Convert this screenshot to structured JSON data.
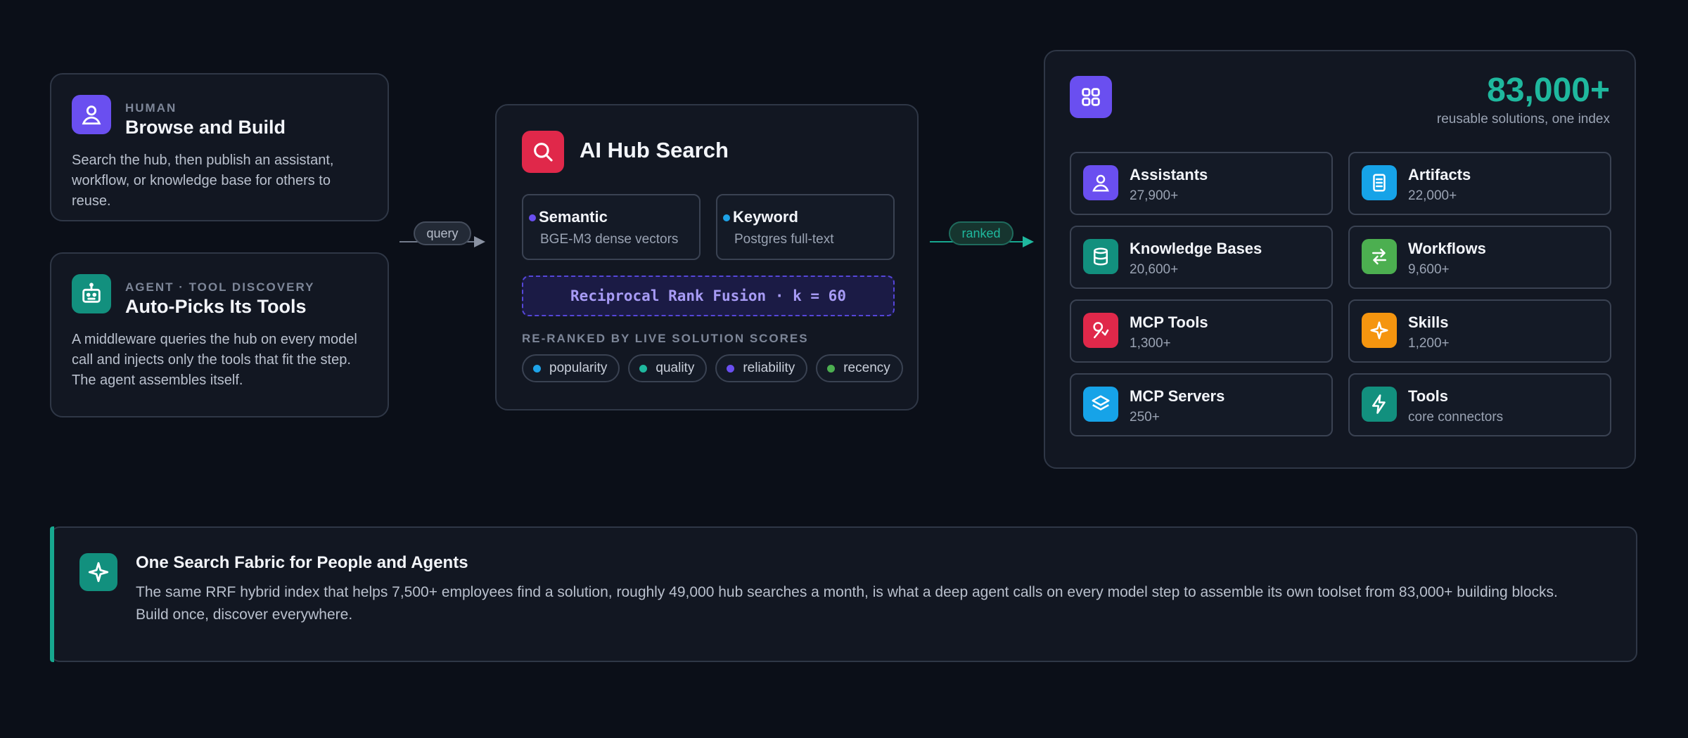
{
  "human": {
    "eyebrow": "HUMAN",
    "title": "Browse and Build",
    "body": "Search the hub, then publish an assistant, workflow, or knowledge base for others to reuse.",
    "icon": "person-icon"
  },
  "agent": {
    "eyebrow": "AGENT · TOOL DISCOVERY",
    "title": "Auto-Picks Its Tools",
    "body": "A middleware queries the hub on every model call and injects only the tools that fit the step. The agent assembles itself.",
    "icon": "robot-icon"
  },
  "query_label": "query",
  "ranked_label": "ranked",
  "search": {
    "title": "AI Hub Search",
    "icon": "search-icon",
    "semantic": {
      "title": "Semantic",
      "sub": "BGE-M3 dense vectors"
    },
    "keyword": {
      "title": "Keyword",
      "sub": "Postgres full-text"
    },
    "fusion": "Reciprocal Rank Fusion · k = 60",
    "rerank_label": "RE-RANKED BY LIVE SOLUTION SCORES",
    "chips": [
      {
        "label": "popularity",
        "color": "#1ea3e8"
      },
      {
        "label": "quality",
        "color": "#1fb89e"
      },
      {
        "label": "reliability",
        "color": "#6a4ff0"
      },
      {
        "label": "recency",
        "color": "#4caf50"
      }
    ]
  },
  "catalog": {
    "count": "83,000+",
    "count_sub": "reusable solutions, one index",
    "icon": "grid-icon",
    "items": [
      {
        "name": "Assistants",
        "count": "27,900+",
        "icon": "person-icon",
        "color": "#6a4ff0"
      },
      {
        "name": "Artifacts",
        "count": "22,000+",
        "icon": "document-icon",
        "color": "#16a3e8"
      },
      {
        "name": "Knowledge Bases",
        "count": "20,600+",
        "icon": "database-icon",
        "color": "#12907e"
      },
      {
        "name": "Workflows",
        "count": "9,600+",
        "icon": "swap-arrows-icon",
        "color": "#4caf50"
      },
      {
        "name": "MCP Tools",
        "count": "1,300+",
        "icon": "wrench-icon",
        "color": "#e0284a"
      },
      {
        "name": "Skills",
        "count": "1,200+",
        "icon": "sparkle-icon",
        "color": "#f5950f"
      },
      {
        "name": "MCP Servers",
        "count": "250+",
        "icon": "layers-icon",
        "color": "#16a3e8"
      },
      {
        "name": "Tools",
        "count": "core connectors",
        "icon": "bolt-icon",
        "color": "#12907e"
      }
    ]
  },
  "banner": {
    "title": "One Search Fabric for People and Agents",
    "body": "The same RRF hybrid index that helps 7,500+ employees find a solution, roughly 49,000 hub searches a month, is what a deep agent calls on every model step to assemble its own toolset from 83,000+ building blocks. Build once, discover everywhere.",
    "icon": "sparkle-icon"
  },
  "colors": {
    "accent_teal": "#1fb89e",
    "violet": "#6a4ff0",
    "crimson": "#e0284a"
  }
}
